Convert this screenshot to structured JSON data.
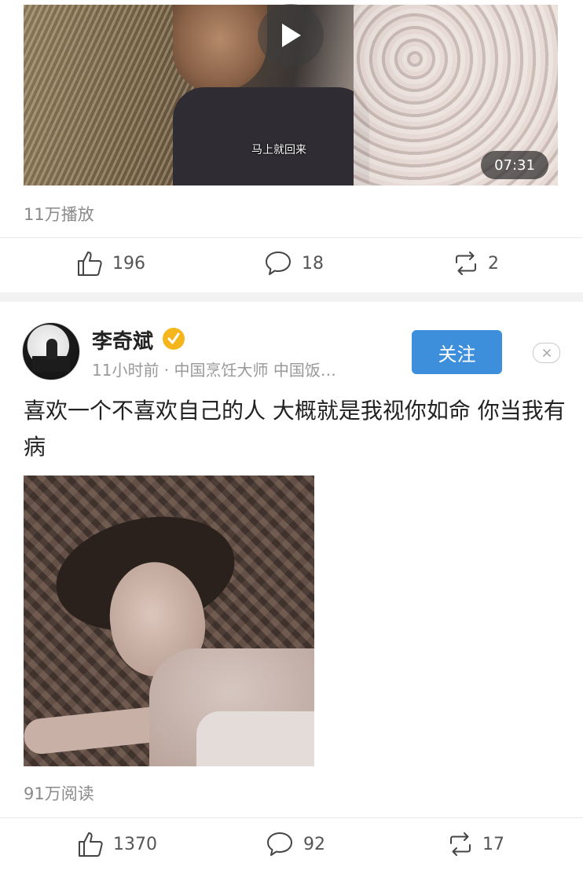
{
  "posts": [
    {
      "video": {
        "subtitle": "马上就回来",
        "duration": "07:31",
        "play_icon": "play-icon"
      },
      "play_count": "11万播放",
      "actions": {
        "likes": "196",
        "comments": "18",
        "reposts": "2"
      }
    },
    {
      "author": {
        "name": "李奇斌",
        "verified_icon": "verified-badge-icon",
        "meta": "11小时前 · 中国烹饪大师 中国饭…"
      },
      "follow_label": "关注",
      "close_icon": "close-icon",
      "text": "喜欢一个不喜欢自己的人 大概就是我视你如命 你当我有病",
      "read_count": "91万阅读",
      "actions": {
        "likes": "1370",
        "comments": "92",
        "reposts": "17"
      }
    }
  ],
  "colors": {
    "accent": "#3d8fdc",
    "verified": "#f4b61a",
    "muted_text": "#8a8a8a",
    "separator": "#f2f2f2"
  }
}
